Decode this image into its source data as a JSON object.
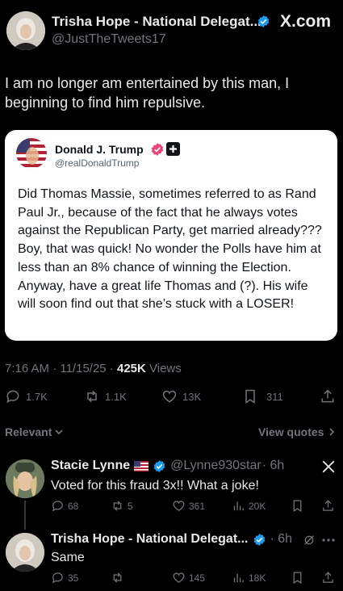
{
  "header": {
    "author_name": "Trisha Hope - National Delegat...",
    "author_handle": "@JustTheTweets17",
    "site_label": "X.com"
  },
  "post": {
    "text": "I am no longer am entertained by this man, I beginning to find him repulsive."
  },
  "quoted": {
    "author_name": "Donald J. Trump",
    "author_handle": "@realDonaldTrump",
    "text": "Did Thomas Massie, sometimes referred to as Rand Paul Jr., because of the fact that he always votes against the Republican Party, get married already??? Boy, that was quick! No wonder the Polls have him at less than an 8% chance of winning the Election. Anyway, have a great life Thomas and (?). His wife will soon find out that she’s stuck with a LOSER!"
  },
  "meta": {
    "timestamp": "7:16 AM · 11/15/25 · ",
    "views_count": "425K",
    "views_label": " Views"
  },
  "actions": {
    "replies": "1.7K",
    "reposts": "1.1K",
    "likes": "13K",
    "bookmarks": "311"
  },
  "sort": {
    "relevant_label": "Relevant",
    "view_quotes_label": "View quotes"
  },
  "replies": [
    {
      "author_name": "Stacie Lynne",
      "author_handle": "@Lynne930star",
      "time": "· 6h",
      "text": "Voted for this fraud 3x!! What a joke!",
      "replies": "68",
      "reposts": "5",
      "likes": "361",
      "views": "20K"
    },
    {
      "author_name": "Trisha Hope - National Delegat...",
      "time": "· 6h",
      "text": "Same",
      "replies": "35",
      "reposts": "",
      "likes": "145",
      "views": "18K"
    }
  ],
  "colors": {
    "background": "#000000",
    "verified_blue": "#1d9bf0",
    "muted": "#71767b",
    "text": "#e7e9ea"
  }
}
